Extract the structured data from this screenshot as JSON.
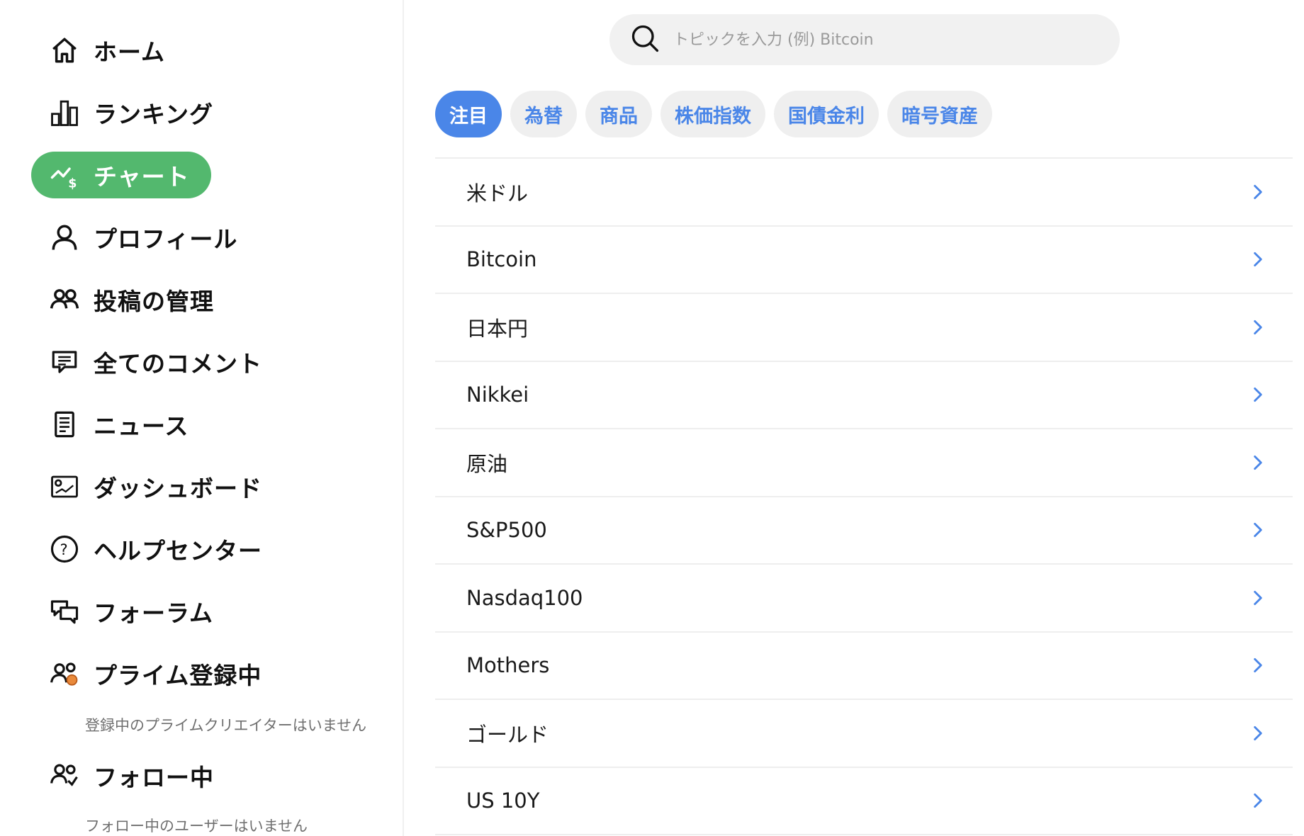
{
  "sidebar": {
    "items": [
      {
        "label": "ホーム",
        "icon": "home-icon",
        "active": false
      },
      {
        "label": "ランキング",
        "icon": "ranking-icon",
        "active": false
      },
      {
        "label": "チャート",
        "icon": "chart-icon",
        "active": true
      },
      {
        "label": "プロフィール",
        "icon": "user-icon",
        "active": false
      },
      {
        "label": "投稿の管理",
        "icon": "users-icon",
        "active": false
      },
      {
        "label": "全てのコメント",
        "icon": "comment-icon",
        "active": false
      },
      {
        "label": "ニュース",
        "icon": "news-icon",
        "active": false
      },
      {
        "label": "ダッシュボード",
        "icon": "dashboard-icon",
        "active": false
      },
      {
        "label": "ヘルプセンター",
        "icon": "help-icon",
        "active": false
      },
      {
        "label": "フォーラム",
        "icon": "forum-icon",
        "active": false
      },
      {
        "label": "プライム登録中",
        "icon": "prime-icon",
        "active": false
      },
      {
        "label": "フォロー中",
        "icon": "following-icon",
        "active": false
      }
    ],
    "prime_empty": "登録中のプライムクリエイターはいません",
    "following_empty": "フォロー中のユーザーはいません"
  },
  "search": {
    "placeholder": "トピックを入力 (例) Bitcoin",
    "value": ""
  },
  "tabs": [
    {
      "label": "注目",
      "active": true
    },
    {
      "label": "為替",
      "active": false
    },
    {
      "label": "商品",
      "active": false
    },
    {
      "label": "株価指数",
      "active": false
    },
    {
      "label": "国債金利",
      "active": false
    },
    {
      "label": "暗号資産",
      "active": false
    }
  ],
  "topics": [
    {
      "label": "米ドル"
    },
    {
      "label": "Bitcoin"
    },
    {
      "label": "日本円"
    },
    {
      "label": "Nikkei"
    },
    {
      "label": "原油"
    },
    {
      "label": "S&P500"
    },
    {
      "label": "Nasdaq100"
    },
    {
      "label": "Mothers"
    },
    {
      "label": "ゴールド"
    },
    {
      "label": "US 10Y"
    }
  ],
  "colors": {
    "active_nav_bg": "#53b86e",
    "accent_blue": "#4a86e8",
    "tab_bg": "#efefef",
    "divider": "#eeeeee"
  }
}
